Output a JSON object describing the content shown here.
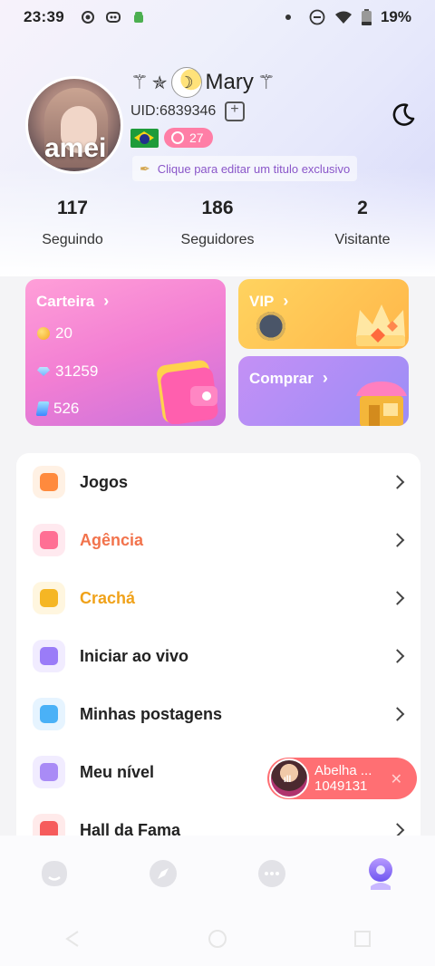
{
  "status_bar": {
    "time": "23:39",
    "battery": "19%"
  },
  "profile": {
    "avatar_text": "amei",
    "name": "Mary",
    "uid": "UID:6839346",
    "level": "27",
    "edit_title": "Clique para editar um titulo exclusivo"
  },
  "stats": [
    {
      "value": "117",
      "label": "Seguindo"
    },
    {
      "value": "186",
      "label": "Seguidores"
    },
    {
      "value": "2",
      "label": "Visitante"
    }
  ],
  "wallet": {
    "title": "Carteira",
    "coins": "20",
    "diamonds": "31259",
    "tickets": "526"
  },
  "vip": {
    "title": "VIP"
  },
  "buy": {
    "title": "Comprar"
  },
  "menu": [
    {
      "label": "Jogos",
      "color": "#222222",
      "icon": "gamepad-icon",
      "bg": "#fff1e4",
      "fg": "#ff8a3d"
    },
    {
      "label": "Agência",
      "color": "#f2734c",
      "icon": "gift-icon",
      "bg": "#ffe9ef",
      "fg": "#ff6f94"
    },
    {
      "label": "Crachá",
      "color": "#f0a21a",
      "icon": "badge-icon",
      "bg": "#fff6df",
      "fg": "#f5b624"
    },
    {
      "label": "Iniciar ao vivo",
      "color": "#222222",
      "icon": "camera-icon",
      "bg": "#f1ecff",
      "fg": "#9a7cf8"
    },
    {
      "label": "Minhas postagens",
      "color": "#222222",
      "icon": "planet-icon",
      "bg": "#e6f4ff",
      "fg": "#4ab1f7"
    },
    {
      "label": "Meu nível",
      "color": "#222222",
      "icon": "crown-icon",
      "bg": "#f1ecff",
      "fg": "#a98bf6"
    },
    {
      "label": "Hall da Fama",
      "color": "#222222",
      "icon": "trophy-icon",
      "bg": "#ffeaea",
      "fg": "#f65c5c"
    }
  ],
  "live_float": {
    "name": "Abelha ...",
    "id": "1049131"
  },
  "nav": [
    "home-icon",
    "explore-icon",
    "chat-icon",
    "profile-icon"
  ],
  "colors": {
    "accent": "#9a7cf8",
    "wallet_pink": "#f27ed3",
    "vip_gold": "#ffc24a"
  }
}
